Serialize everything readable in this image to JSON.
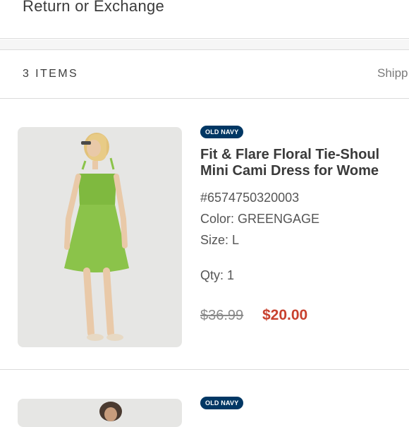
{
  "header": {
    "title": "Return or Exchange"
  },
  "summary": {
    "items_label": "3 ITEMS",
    "shipping_label": "Shipp"
  },
  "products": [
    {
      "brand": "OLD NAVY",
      "title_line1": "Fit & Flare Floral Tie-Shoul",
      "title_line2": "Mini Cami Dress for Wome",
      "sku": "#6574750320003",
      "color": "Color: GREENGAGE",
      "size": "Size: L",
      "qty": "Qty: 1",
      "price_original": "$36.99",
      "price_sale": "$20.00"
    },
    {
      "brand": "OLD NAVY"
    }
  ],
  "colors": {
    "brand_badge": "#003764",
    "sale_price": "#c8412e",
    "dress": "#8bc34a"
  }
}
